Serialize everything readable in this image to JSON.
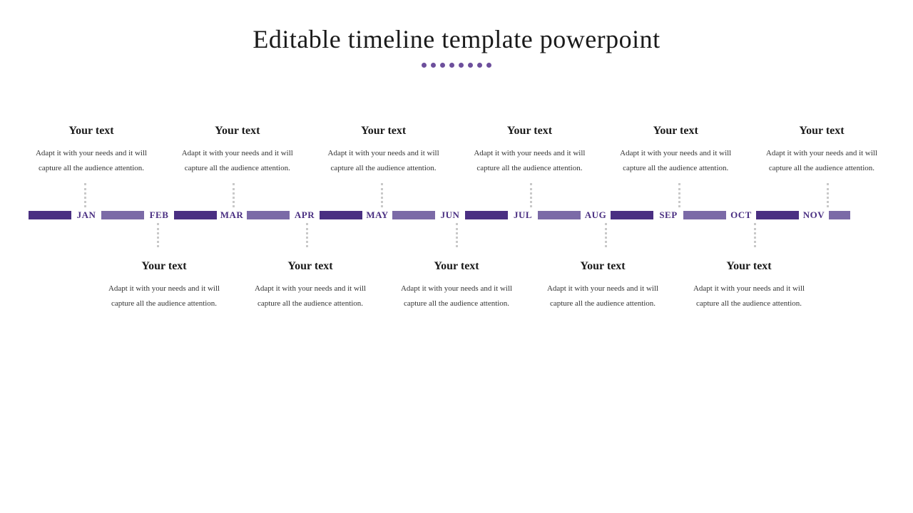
{
  "title": "Editable timeline template powerpoint",
  "months": [
    "JAN",
    "FEB",
    "MAR",
    "APR",
    "MAY",
    "JUN",
    "JUL",
    "AUG",
    "SEP",
    "OCT",
    "NOV"
  ],
  "top": [
    {
      "title": "Your text",
      "body": "Adapt it with your needs and it will capture all the audience attention."
    },
    {
      "title": "Your text",
      "body": "Adapt it with your needs and it will capture all the audience attention."
    },
    {
      "title": "Your text",
      "body": "Adapt it with your needs and it will capture all the audience attention."
    },
    {
      "title": "Your text",
      "body": "Adapt it with your needs and it will capture all the audience attention."
    },
    {
      "title": "Your text",
      "body": "Adapt it with your needs and it will capture all the audience attention."
    },
    {
      "title": "Your text",
      "body": "Adapt it with your needs and it will capture all the audience attention."
    }
  ],
  "bottom": [
    {
      "title": "Your text",
      "body": "Adapt it with your needs and it will capture all the audience attention."
    },
    {
      "title": "Your text",
      "body": "Adapt it with your needs and it will capture all the audience attention."
    },
    {
      "title": "Your text",
      "body": "Adapt it with your needs and it will capture all the audience attention."
    },
    {
      "title": "Your text",
      "body": "Adapt it with your needs and it will capture all the audience attention."
    },
    {
      "title": "Your text",
      "body": "Adapt it with your needs and it will capture all the audience attention."
    }
  ]
}
